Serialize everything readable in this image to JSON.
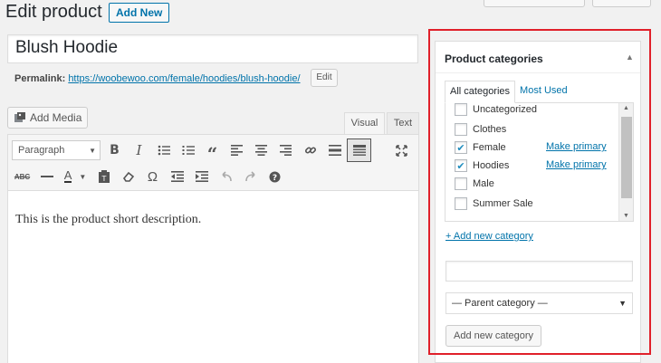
{
  "page": {
    "heading": "Edit product",
    "add_new_label": "Add New",
    "title_value": "Blush Hoodie",
    "permalink_label": "Permalink:",
    "permalink_url": "https://woobewoo.com/female/hoodies/blush-hoodie/",
    "edit_label": "Edit"
  },
  "editor": {
    "add_media_label": "Add Media",
    "tabs": {
      "visual": "Visual",
      "text": "Text"
    },
    "format_select": "Paragraph",
    "content": "This is the product short description.",
    "toolbar_row1": [
      "bold-icon",
      "italic-icon",
      "bullet-list-icon",
      "numbered-list-icon",
      "blockquote-icon",
      "align-left-icon",
      "align-center-icon",
      "align-right-icon",
      "link-icon",
      "horizontal-rule-icon",
      "toolbar-toggle-icon",
      "fullscreen-icon"
    ],
    "toolbar_row2": [
      "strikethrough-icon",
      "horizontal-line-icon",
      "text-color-icon",
      "paste-text-icon",
      "clear-format-icon",
      "special-character-icon",
      "outdent-icon",
      "indent-icon",
      "undo-icon",
      "redo-icon",
      "help-icon"
    ]
  },
  "categories_panel": {
    "title": "Product categories",
    "tab_all": "All categories",
    "tab_most_used": "Most Used",
    "items": [
      {
        "label": "Uncategorized",
        "checked": false,
        "make_primary": ""
      },
      {
        "label": "Clothes",
        "checked": false,
        "make_primary": ""
      },
      {
        "label": "Female",
        "checked": true,
        "make_primary": "Make primary"
      },
      {
        "label": "Hoodies",
        "checked": true,
        "make_primary": "Make primary"
      },
      {
        "label": "Male",
        "checked": false,
        "make_primary": ""
      },
      {
        "label": "Summer Sale",
        "checked": false,
        "make_primary": ""
      }
    ],
    "add_new_link": "+ Add new category",
    "parent_select": "— Parent category —",
    "add_button": "Add new category"
  },
  "colors": {
    "link": "#0073aa",
    "highlight_border": "#e0202a",
    "checkbox_check": "#1e8cbe"
  }
}
